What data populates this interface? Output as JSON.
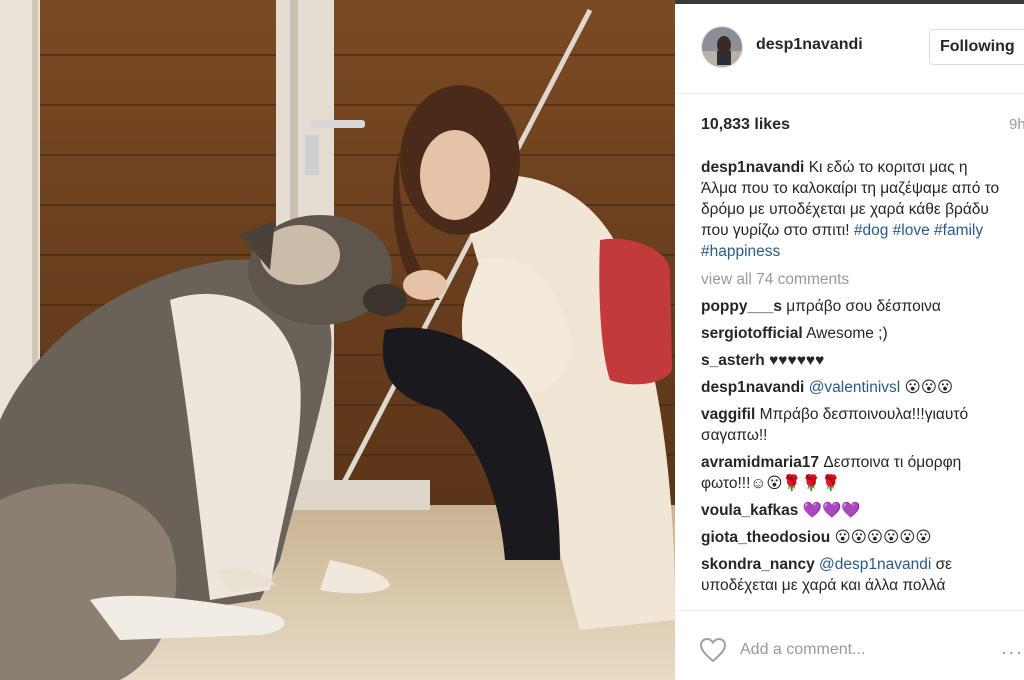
{
  "post": {
    "username": "desp1navandi",
    "follow_label": "Following",
    "likes": "10,833 likes",
    "time": "9h",
    "caption": {
      "text": "Κι εδώ το κοριτσι μας η Άλμα που το καλοκαίρι τη μαζέψαμε από το δρόμο με υποδέχεται με χαρά κάθε βράδυ που γυρίζω στο σπιτι!",
      "tags": [
        "#dog",
        "#love",
        "#family",
        "#happiness"
      ]
    },
    "view_all": "view all 74 comments",
    "comments": [
      {
        "user": "poppy___s",
        "text": "μπράβο σου δέσποινα"
      },
      {
        "user": "sergiotofficial",
        "text": "Awesome ;)"
      },
      {
        "user": "s_asterh",
        "text": "♥♥♥♥♥♥"
      },
      {
        "user": "desp1navandi",
        "mention": "@valentinivsl",
        "text": "😮😮😮"
      },
      {
        "user": "vaggifil",
        "text": "Μπράβο δεσποινουλα!!!γιαυτό σαγαπω!!"
      },
      {
        "user": "avramidmaria17",
        "text": "Δεσποινα τι όμορφη φωτο!!!☺😮🌹🌹🌹"
      },
      {
        "user": "voula_kafkas",
        "text": "💜💜💜"
      },
      {
        "user": "giota_theodosiou",
        "text": "😮😮😮😮😮😮"
      },
      {
        "user": "skondra_nancy",
        "mention": "@desp1navandi",
        "text": "σε υποδέχεται με χαρά και άλλα πολλά"
      }
    ],
    "add_comment_placeholder": "Add a comment...",
    "more_label": "..."
  },
  "icons": {
    "heart": "heart-icon",
    "more": "more-options-icon"
  },
  "colors": {
    "link": "#2a5a8a",
    "muted": "#999999",
    "text": "#262626"
  }
}
